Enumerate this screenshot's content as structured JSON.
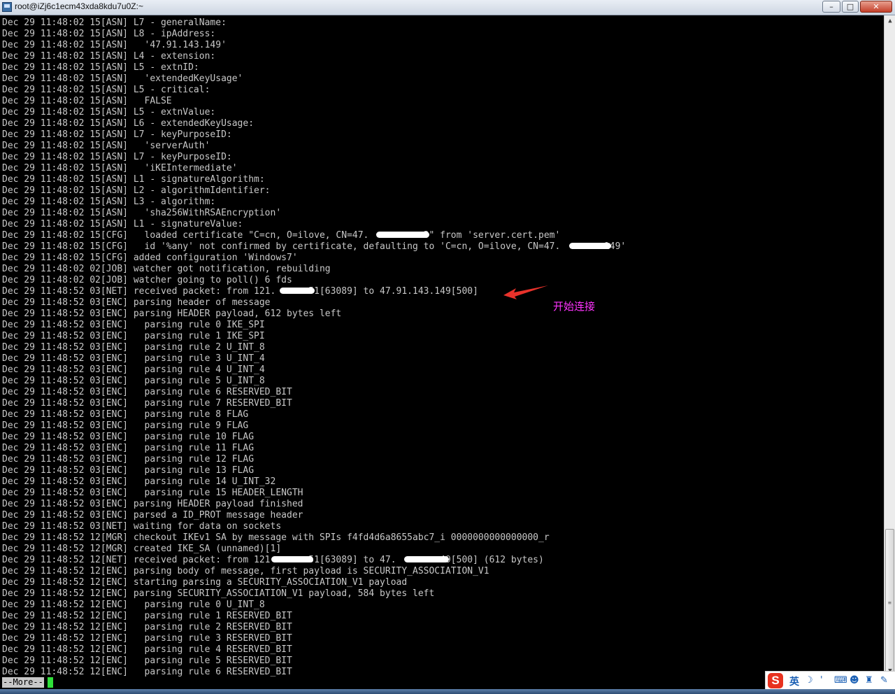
{
  "window": {
    "title": "root@iZj6c1ecm43xda8kdu7u0Z:~",
    "minimize_glyph": "–",
    "maximize_glyph": "□",
    "close_glyph": "✕",
    "icon": "putty-terminal-icon"
  },
  "terminal": {
    "lines": [
      "Dec 29 11:48:02 15[ASN] L7 - generalName:",
      "Dec 29 11:48:02 15[ASN] L8 - ipAddress:",
      "Dec 29 11:48:02 15[ASN]   '47.91.143.149'",
      "Dec 29 11:48:02 15[ASN] L4 - extension:",
      "Dec 29 11:48:02 15[ASN] L5 - extnID:",
      "Dec 29 11:48:02 15[ASN]   'extendedKeyUsage'",
      "Dec 29 11:48:02 15[ASN] L5 - critical:",
      "Dec 29 11:48:02 15[ASN]   FALSE",
      "Dec 29 11:48:02 15[ASN] L5 - extnValue:",
      "Dec 29 11:48:02 15[ASN] L6 - extendedKeyUsage:",
      "Dec 29 11:48:02 15[ASN] L7 - keyPurposeID:",
      "Dec 29 11:48:02 15[ASN]   'serverAuth'",
      "Dec 29 11:48:02 15[ASN] L7 - keyPurposeID:",
      "Dec 29 11:48:02 15[ASN]   'iKEIntermediate'",
      "Dec 29 11:48:02 15[ASN] L1 - signatureAlgorithm:",
      "Dec 29 11:48:02 15[ASN] L2 - algorithmIdentifier:",
      "Dec 29 11:48:02 15[ASN] L3 - algorithm:",
      "Dec 29 11:48:02 15[ASN]   'sha256WithRSAEncryption'",
      "Dec 29 11:48:02 15[ASN] L1 - signatureValue:",
      "Dec 29 11:48:02 15[CFG]   loaded certificate \"C=cn, O=ilove, CN=47.          3\" from 'server.cert.pem'",
      "Dec 29 11:48:02 15[CFG]   id '%any' not confirmed by certificate, defaulting to 'C=cn, O=ilove, CN=47.        149'",
      "Dec 29 11:48:02 15[CFG] added configuration 'Windows7'",
      "Dec 29 11:48:02 02[JOB] watcher got notification, rebuilding",
      "Dec 29 11:48:02 02[JOB] watcher going to poll() 6 fds",
      "Dec 29 11:48:52 03[NET] received packet: from 121.      51[63089] to 47.91.143.149[500]",
      "Dec 29 11:48:52 03[ENC] parsing header of message",
      "Dec 29 11:48:52 03[ENC] parsing HEADER payload, 612 bytes left",
      "Dec 29 11:48:52 03[ENC]   parsing rule 0 IKE_SPI",
      "Dec 29 11:48:52 03[ENC]   parsing rule 1 IKE_SPI",
      "Dec 29 11:48:52 03[ENC]   parsing rule 2 U_INT_8",
      "Dec 29 11:48:52 03[ENC]   parsing rule 3 U_INT_4",
      "Dec 29 11:48:52 03[ENC]   parsing rule 4 U_INT_4",
      "Dec 29 11:48:52 03[ENC]   parsing rule 5 U_INT_8",
      "Dec 29 11:48:52 03[ENC]   parsing rule 6 RESERVED_BIT",
      "Dec 29 11:48:52 03[ENC]   parsing rule 7 RESERVED_BIT",
      "Dec 29 11:48:52 03[ENC]   parsing rule 8 FLAG",
      "Dec 29 11:48:52 03[ENC]   parsing rule 9 FLAG",
      "Dec 29 11:48:52 03[ENC]   parsing rule 10 FLAG",
      "Dec 29 11:48:52 03[ENC]   parsing rule 11 FLAG",
      "Dec 29 11:48:52 03[ENC]   parsing rule 12 FLAG",
      "Dec 29 11:48:52 03[ENC]   parsing rule 13 FLAG",
      "Dec 29 11:48:52 03[ENC]   parsing rule 14 U_INT_32",
      "Dec 29 11:48:52 03[ENC]   parsing rule 15 HEADER_LENGTH",
      "Dec 29 11:48:52 03[ENC] parsing HEADER payload finished",
      "Dec 29 11:48:52 03[ENC] parsed a ID_PROT message header",
      "Dec 29 11:48:52 03[NET] waiting for data on sockets",
      "Dec 29 11:48:52 12[MGR] checkout IKEv1 SA by message with SPIs f4fd4d6a8655abc7_i 0000000000000000_r",
      "Dec 29 11:48:52 12[MGR] created IKE_SA (unnamed)[1]",
      "Dec 29 11:48:52 12[NET] received packet: from 121       51[63089] to 47.        49[500] (612 bytes)",
      "Dec 29 11:48:52 12[ENC] parsing body of message, first payload is SECURITY_ASSOCIATION_V1",
      "Dec 29 11:48:52 12[ENC] starting parsing a SECURITY_ASSOCIATION_V1 payload",
      "Dec 29 11:48:52 12[ENC] parsing SECURITY_ASSOCIATION_V1 payload, 584 bytes left",
      "Dec 29 11:48:52 12[ENC]   parsing rule 0 U_INT_8",
      "Dec 29 11:48:52 12[ENC]   parsing rule 1 RESERVED_BIT",
      "Dec 29 11:48:52 12[ENC]   parsing rule 2 RESERVED_BIT",
      "Dec 29 11:48:52 12[ENC]   parsing rule 3 RESERVED_BIT",
      "Dec 29 11:48:52 12[ENC]   parsing rule 4 RESERVED_BIT",
      "Dec 29 11:48:52 12[ENC]   parsing rule 5 RESERVED_BIT",
      "Dec 29 11:48:52 12[ENC]   parsing rule 6 RESERVED_BIT"
    ],
    "pager_prompt": "--More--",
    "text_color": "#c8c8c8",
    "background_color": "#000000",
    "cursor_color": "#2fe03a"
  },
  "annotation": {
    "text": "开始连接",
    "color": "#ff33ff",
    "arrow_color": "#e8322b"
  },
  "ime_toolbar": {
    "logo": "S",
    "language": "英",
    "moon_icon": "☽",
    "punct_icon": "'",
    "keyboard_icon": "⌨",
    "user_icon": "☻",
    "shirt_icon": "♜",
    "tool_icon": "✎"
  },
  "scrollbar": {
    "up": "▲",
    "down": "▼",
    "grip": "≡"
  }
}
